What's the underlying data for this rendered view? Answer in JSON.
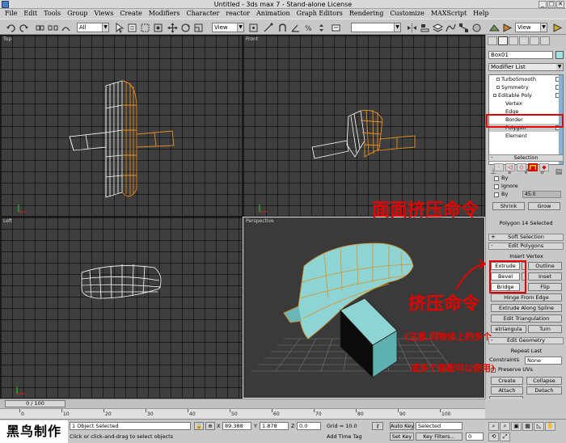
{
  "window": {
    "title": "Untitled - 3ds max 7  - Stand-alone License",
    "min": "_",
    "max": "□",
    "close": "✕"
  },
  "menu": [
    "File",
    "Edit",
    "Tools",
    "Group",
    "Views",
    "Create",
    "Modifiers",
    "Character",
    "reactor",
    "Animation",
    "Graph Editors",
    "Rendering",
    "Customize",
    "MAXScript",
    "Help"
  ],
  "toolbar": {
    "selection_filter": "All",
    "ref_coord": "View",
    "ref_coord2": "View",
    "named_selection": ""
  },
  "viewports": {
    "top": "Top",
    "front": "Front",
    "left": "Left",
    "perspective": "Perspective"
  },
  "command_panel": {
    "object_name": "Box01",
    "object_color": "#a6e0e0",
    "modifier_list": "Modifier List",
    "stack": [
      {
        "label": "TurboSmooth",
        "indent": 1
      },
      {
        "label": "Symmetry",
        "indent": 1
      },
      {
        "label": "Editable Poly",
        "indent": 0
      },
      {
        "label": "Vertex",
        "indent": 2
      },
      {
        "label": "Edge",
        "indent": 2
      },
      {
        "label": "Border",
        "indent": 2
      },
      {
        "label": "Polygon",
        "indent": 2,
        "selected": true
      },
      {
        "label": "Element",
        "indent": 2
      }
    ],
    "selection_title": "Selection",
    "by_vertex": "By",
    "ignore_backfacing": "Ignore",
    "by_angle": "By",
    "angle_value": "45.0",
    "shrink": "Shrink",
    "grow": "Grow",
    "selection_info": "Polygon 14 Selected",
    "soft_selection": "Soft Selection",
    "edit_polygons": "Edit Polygons",
    "insert_vertex": "Insert Vertex",
    "extrude": "Extrude",
    "outline": "Outline",
    "bevel": "Bevel",
    "inset": "Inset",
    "bridge": "Bridge",
    "flip": "Flip",
    "hinge_from_edge": "Hinge From Edge",
    "extrude_along_spline": "Extrude Along Spline",
    "edit_triangulation": "Edit Triangulation",
    "retriangulate": "etriangula",
    "turn": "Turn",
    "edit_geometry": "Edit Geometry",
    "repeat_last": "Repeat Last",
    "constraints": "Constraints",
    "constraints_value": "None",
    "preserve_uvs": "Preserve UVs",
    "create": "Create",
    "collapse": "Collapse",
    "attach": "Attach",
    "detach": "Detach",
    "slice_plane": "Slice Plane",
    "split": "Split"
  },
  "annotations": {
    "top_note": "面面挤压命令",
    "mid_note": "挤压命令",
    "note_line2": "(注意,同物体上的多个",
    "note_line3": "或多个面都可以使用)"
  },
  "timeline": {
    "frame": "0 / 100",
    "ticks": [
      "0",
      "10",
      "20",
      "30",
      "40",
      "50",
      "60",
      "70",
      "80",
      "90",
      "100"
    ]
  },
  "status": {
    "selection": "1 Object Selected",
    "prompt": "Click or click-and-drag to select objects",
    "x_label": "X",
    "x_value": "89.388",
    "y_label": "Y",
    "y_value": "1.878",
    "z_label": "Z",
    "z_value": "0.0",
    "grid": "Grid = 10.0",
    "add_time_tag": "Add Time Tag",
    "auto_key": "Auto Key",
    "selected": "Selected",
    "set_key": "Set Key",
    "key_filters": "Key Filters...",
    "frame_num": "0"
  },
  "logo_text": "黑鸟制作"
}
